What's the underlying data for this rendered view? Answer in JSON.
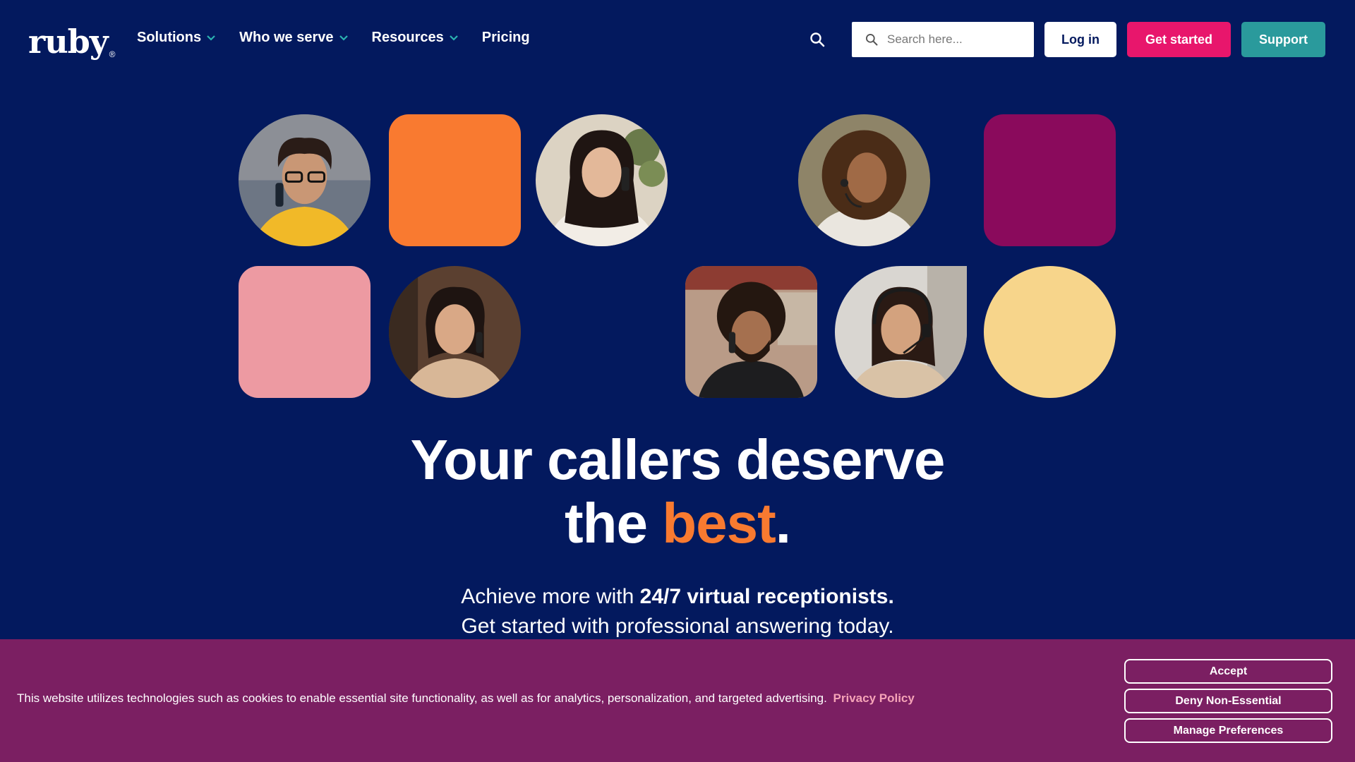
{
  "header": {
    "logo": "ruby",
    "logo_mark": "®",
    "nav": [
      {
        "label": "Solutions",
        "has_dropdown": true
      },
      {
        "label": "Who we serve",
        "has_dropdown": true
      },
      {
        "label": "Resources",
        "has_dropdown": true
      },
      {
        "label": "Pricing",
        "has_dropdown": false
      }
    ],
    "search_placeholder": "Search here...",
    "login_label": "Log in",
    "get_started_label": "Get started",
    "support_label": "Support"
  },
  "hero": {
    "headline_line1": "Your callers deserve",
    "headline_line2_start": "the ",
    "headline_accent": "best",
    "headline_end": ".",
    "sub_line1_start": "Achieve more with ",
    "sub_line1_bold": "24/7 virtual receptionists.",
    "sub_line2": "Get started with professional answering today."
  },
  "cookie": {
    "text": "This website utilizes technologies such as cookies to enable essential site functionality, as well as for analytics, personalization, and targeted advertising.",
    "link": "Privacy Policy",
    "accept": "Accept",
    "deny": "Deny Non-Essential",
    "manage": "Manage Preferences"
  },
  "colors": {
    "background": "#03195e",
    "accent_orange": "#f97a30",
    "pink_button": "#e8166c",
    "teal_button": "#2a9a9c",
    "cookie_bg": "#7b1f62",
    "tile_orange": "#f97a30",
    "tile_purple": "#8a0a5c",
    "tile_pink": "#ed9aa2",
    "tile_yellow": "#f7d58b"
  }
}
